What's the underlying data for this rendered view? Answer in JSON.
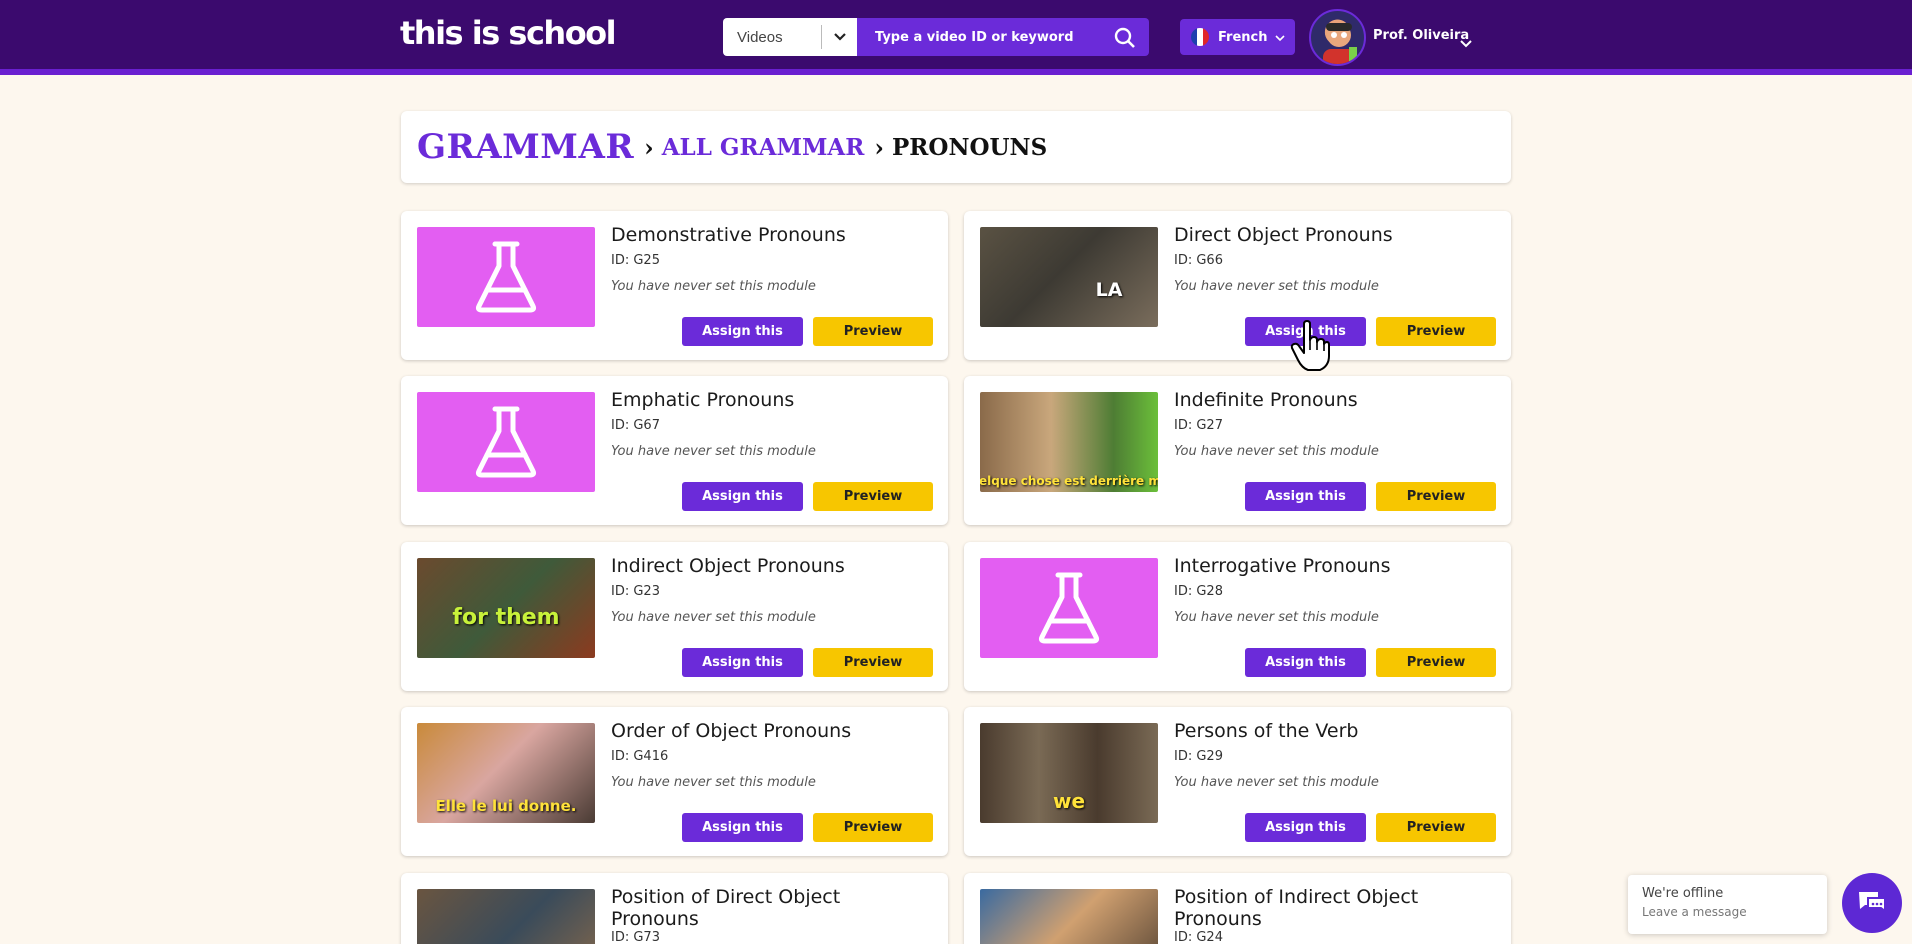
{
  "header": {
    "logo": "this is school",
    "search_scope": "Videos",
    "search_placeholder": "Type a video ID or keyword",
    "language": "French",
    "profile_name": "Prof. Oliveira"
  },
  "breadcrumb": {
    "level1": "GRAMMAR",
    "level2": "ALL GRAMMAR",
    "level3": "PRONOUNS"
  },
  "modules": [
    {
      "title": "Demonstrative Pronouns",
      "id": "ID: G25",
      "status": "You have never set this module",
      "assign": "Assign this",
      "preview": "Preview",
      "thumb": "placeholder"
    },
    {
      "title": "Direct Object Pronouns",
      "id": "ID: G66",
      "status": "You have never set this module",
      "assign": "Assign this",
      "preview": "Preview",
      "thumb": "video",
      "caption": "LA"
    },
    {
      "title": "Emphatic Pronouns",
      "id": "ID: G67",
      "status": "You have never set this module",
      "assign": "Assign this",
      "preview": "Preview",
      "thumb": "placeholder"
    },
    {
      "title": "Indefinite Pronouns",
      "id": "ID: G27",
      "status": "You have never set this module",
      "assign": "Assign this",
      "preview": "Preview",
      "thumb": "video",
      "caption": "Quelque chose est derrière moi."
    },
    {
      "title": "Indirect Object Pronouns",
      "id": "ID: G23",
      "status": "You have never set this module",
      "assign": "Assign this",
      "preview": "Preview",
      "thumb": "video",
      "caption": "for them"
    },
    {
      "title": "Interrogative Pronouns",
      "id": "ID: G28",
      "status": "You have never set this module",
      "assign": "Assign this",
      "preview": "Preview",
      "thumb": "placeholder"
    },
    {
      "title": "Order of Object Pronouns",
      "id": "ID: G416",
      "status": "You have never set this module",
      "assign": "Assign this",
      "preview": "Preview",
      "thumb": "video",
      "caption": "Elle le lui donne."
    },
    {
      "title": "Persons of the Verb",
      "id": "ID: G29",
      "status": "You have never set this module",
      "assign": "Assign this",
      "preview": "Preview",
      "thumb": "video",
      "caption": "we"
    },
    {
      "title": "Position of Direct Object Pronouns",
      "id": "ID: G73",
      "thumb": "video"
    },
    {
      "title": "Position of Indirect Object Pronouns",
      "id": "ID: G24",
      "thumb": "video"
    }
  ],
  "chat": {
    "status": "We're offline",
    "action": "Leave a message"
  },
  "colors": {
    "header_bg": "#3b0a6e",
    "accent_purple": "#6b2bd9",
    "preview_yellow": "#f7c600",
    "placeholder_pink": "#e35ef2",
    "page_bg": "#fdf7ee"
  }
}
